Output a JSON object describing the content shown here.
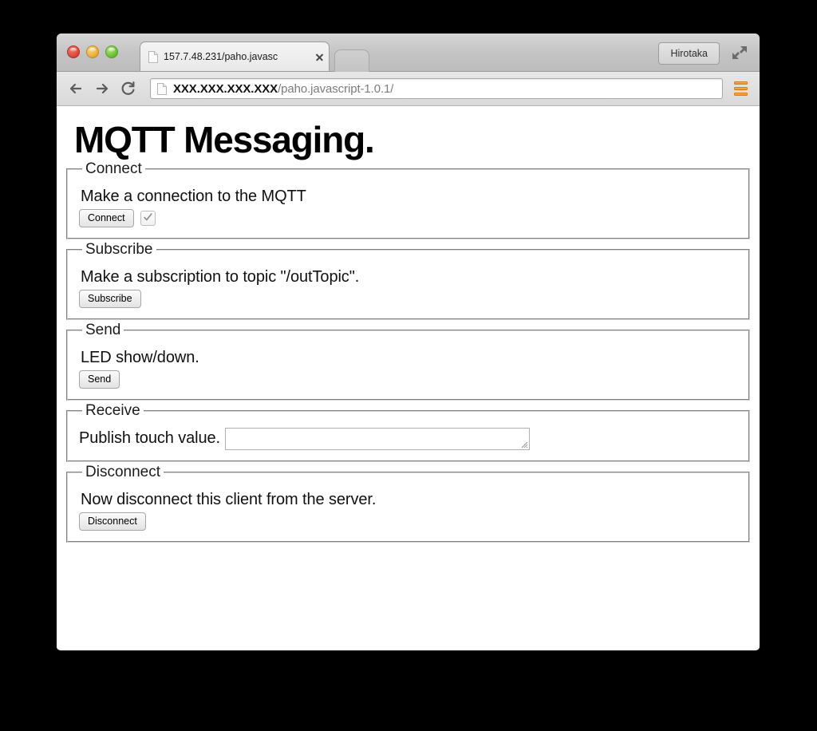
{
  "browser": {
    "tab": {
      "title": "157.7.48.231/paho.javasc",
      "favicon_icon": "page-icon",
      "close_icon": "close-icon"
    },
    "new_tab_icon": "new-tab-button",
    "profile_label": "Hirotaka",
    "fullscreen_icon": "fullscreen-icon",
    "nav": {
      "back_icon": "back-arrow-icon",
      "forward_icon": "forward-arrow-icon",
      "reload_icon": "reload-icon"
    },
    "omnibox": {
      "favicon_icon": "page-icon",
      "host": "XXX.XXX.XXX.XXX",
      "path": "/paho.javascript-1.0.1/"
    },
    "menu_icon": "hamburger-menu-icon",
    "menu_accent_color": "#f08c14"
  },
  "page": {
    "title": "MQTT Messaging.",
    "sections": [
      {
        "legend": "Connect",
        "text": "Make a connection to the MQTT",
        "button": "Connect",
        "checkbox_checked": true
      },
      {
        "legend": "Subscribe",
        "text": "Make a subscription to topic \"/outTopic\".",
        "button": "Subscribe"
      },
      {
        "legend": "Send",
        "text": "LED show/down.",
        "button": "Send"
      },
      {
        "legend": "Receive",
        "text": "Publish touch value.",
        "textarea_value": "",
        "textarea_placeholder": ""
      },
      {
        "legend": "Disconnect",
        "text": "Now disconnect this client from the server.",
        "button": "Disconnect"
      }
    ]
  }
}
